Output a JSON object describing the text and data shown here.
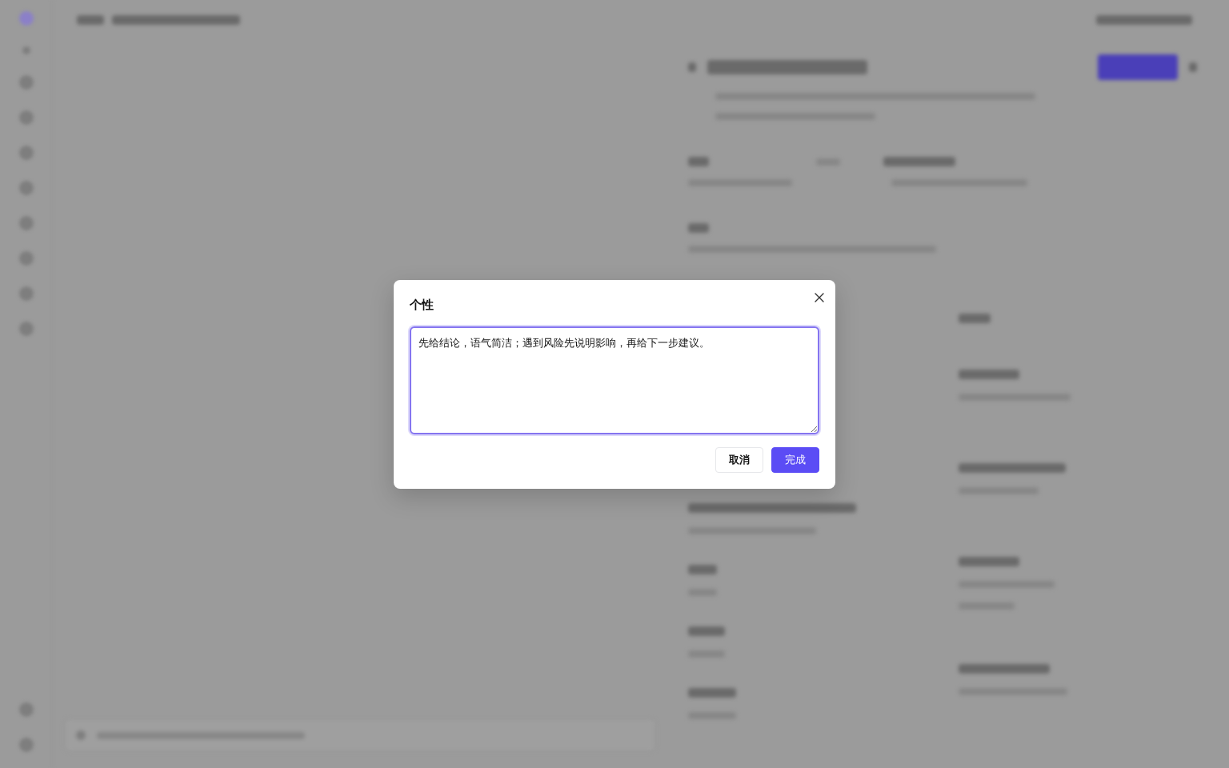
{
  "dialog": {
    "title": "个性",
    "textarea": {
      "value": "先给结论，语气简洁；遇到风险先说明影响，再给下一步建议。",
      "focused": true
    },
    "buttons": [
      {
        "label": "取消",
        "kind": "secondary"
      },
      {
        "label": "完成",
        "kind": "primary"
      }
    ]
  }
}
